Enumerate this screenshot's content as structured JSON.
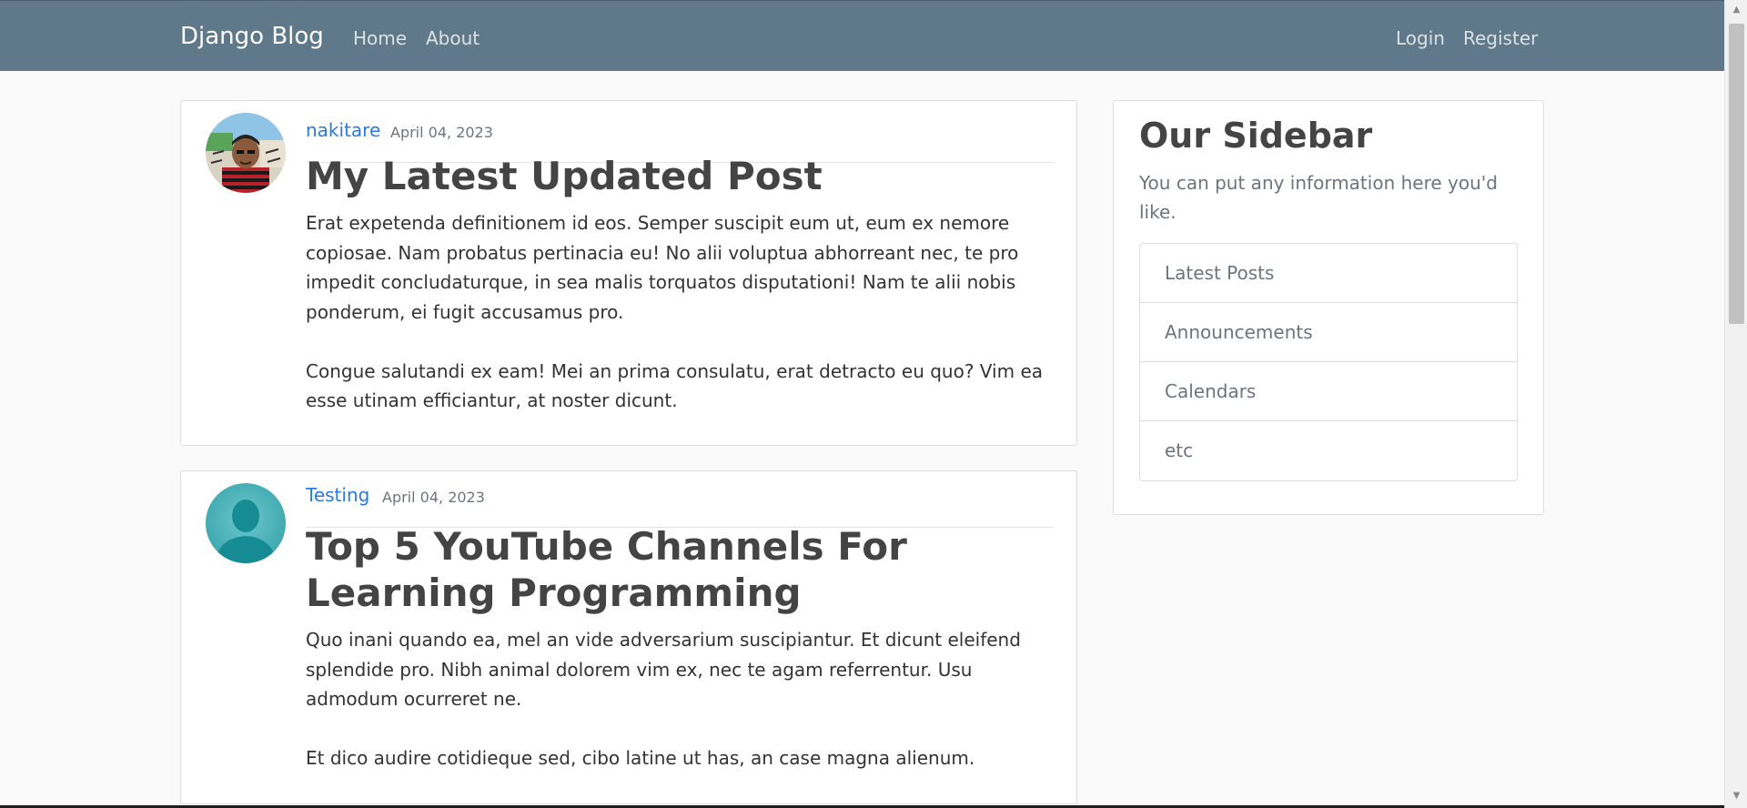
{
  "navbar": {
    "brand": "Django Blog",
    "links": [
      {
        "label": "Home"
      },
      {
        "label": "About"
      }
    ],
    "auth_links": [
      {
        "label": "Login"
      },
      {
        "label": "Register"
      }
    ],
    "background_color": "#5f788a"
  },
  "posts": [
    {
      "author": "nakitare",
      "date": "April 04, 2023",
      "title": "My Latest Updated Post",
      "content": "Erat expetenda definitionem id eos. Semper suscipit eum ut, eum ex nemore copiosae. Nam probatus pertinacia eu! No alii voluptua abhorreant nec, te pro impedit concludaturque, in sea malis torquatos disputationi! Nam te alii nobis ponderum, ei fugit accusamus pro.\n\nCongue salutandi ex eam! Mei an prima consulatu, erat detracto eu quo? Vim ea esse utinam efficiantur, at noster dicunt.",
      "avatar_icon": "cartoon-avatar"
    },
    {
      "author": "Testing",
      "date": "April 04, 2023",
      "title": "Top 5 YouTube Channels For Learning Programming",
      "content": "Quo inani quando ea, mel an vide adversarium suscipiantur. Et dicunt eleifend splendide pro. Nibh animal dolorem vim ex, nec te agam referrentur. Usu admodum ocurreret ne.\n\nEt dico audire cotidieque sed, cibo latine ut has, an case magna alienum.",
      "avatar_icon": "default-user-avatar"
    }
  ],
  "sidebar": {
    "title": "Our Sidebar",
    "text": "You can put any information here you'd like.",
    "items": [
      {
        "label": "Latest Posts"
      },
      {
        "label": "Announcements"
      },
      {
        "label": "Calendars"
      },
      {
        "label": "etc"
      }
    ]
  },
  "colors": {
    "link": "#2a7ae2",
    "muted": "#6c757d",
    "heading": "#444444"
  }
}
